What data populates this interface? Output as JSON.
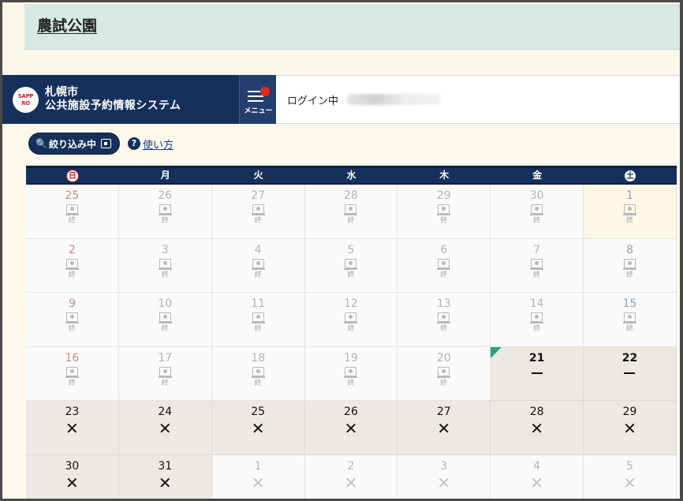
{
  "facility": {
    "name": "農試公園"
  },
  "brand": {
    "logo_line1": "SAPP",
    "logo_line2": "RO",
    "city": "札幌市",
    "system_name": "公共施設予約情報システム"
  },
  "menu": {
    "label": "メニュー"
  },
  "login": {
    "label": "ログイン中"
  },
  "toolbar": {
    "filter_label": "絞り込み中",
    "help_label": "使い方"
  },
  "calendar": {
    "weekdays": [
      "日",
      "月",
      "火",
      "水",
      "木",
      "金",
      "土"
    ],
    "weeks": [
      [
        {
          "day": "25",
          "status": "終"
        },
        {
          "day": "26",
          "status": "終"
        },
        {
          "day": "27",
          "status": "終"
        },
        {
          "day": "28",
          "status": "終"
        },
        {
          "day": "29",
          "status": "終"
        },
        {
          "day": "30",
          "status": "終"
        },
        {
          "day": "1",
          "status": "終"
        }
      ],
      [
        {
          "day": "2",
          "status": "終"
        },
        {
          "day": "3",
          "status": "終"
        },
        {
          "day": "4",
          "status": "終"
        },
        {
          "day": "5",
          "status": "終"
        },
        {
          "day": "6",
          "status": "終"
        },
        {
          "day": "7",
          "status": "終"
        },
        {
          "day": "8",
          "status": "終"
        }
      ],
      [
        {
          "day": "9",
          "status": "終"
        },
        {
          "day": "10",
          "status": "終"
        },
        {
          "day": "11",
          "status": "終"
        },
        {
          "day": "12",
          "status": "終"
        },
        {
          "day": "13",
          "status": "終"
        },
        {
          "day": "14",
          "status": "終"
        },
        {
          "day": "15",
          "status": "終"
        }
      ],
      [
        {
          "day": "16",
          "status": "終"
        },
        {
          "day": "17",
          "status": "終"
        },
        {
          "day": "18",
          "status": "終"
        },
        {
          "day": "19",
          "status": "終"
        },
        {
          "day": "20",
          "status": "終"
        },
        {
          "day": "21",
          "status": "ー"
        },
        {
          "day": "22",
          "status": "ー"
        }
      ],
      [
        {
          "day": "23",
          "status": "✕"
        },
        {
          "day": "24",
          "status": "✕"
        },
        {
          "day": "25",
          "status": "✕"
        },
        {
          "day": "26",
          "status": "✕"
        },
        {
          "day": "27",
          "status": "✕"
        },
        {
          "day": "28",
          "status": "✕"
        },
        {
          "day": "29",
          "status": "✕"
        }
      ],
      [
        {
          "day": "30",
          "status": "✕"
        },
        {
          "day": "31",
          "status": "✕"
        },
        {
          "day": "1",
          "status": "✕"
        },
        {
          "day": "2",
          "status": "✕"
        },
        {
          "day": "3",
          "status": "✕"
        },
        {
          "day": "4",
          "status": "✕"
        },
        {
          "day": "5",
          "status": "✕"
        }
      ]
    ]
  }
}
